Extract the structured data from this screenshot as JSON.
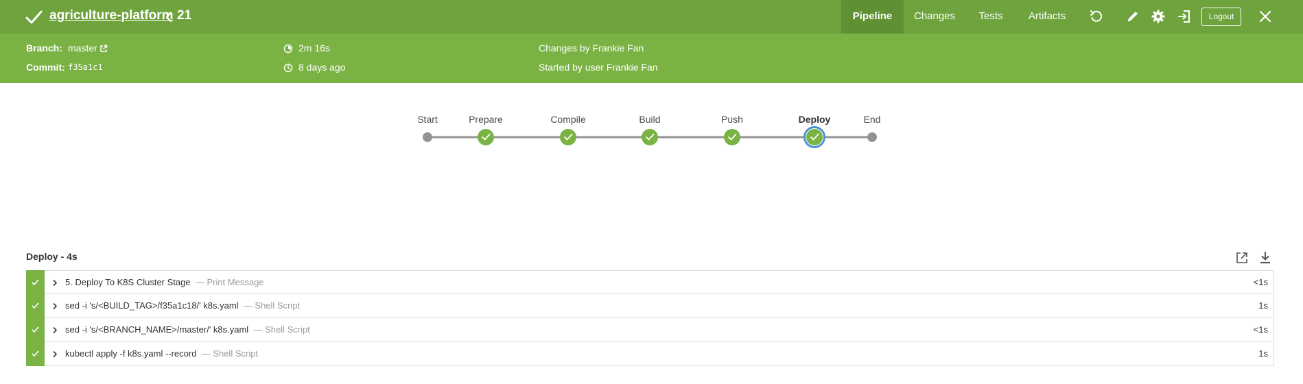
{
  "header": {
    "project": "agriculture-platform",
    "run_number": "21",
    "tabs": [
      {
        "label": "Pipeline"
      },
      {
        "label": "Changes"
      },
      {
        "label": "Tests"
      },
      {
        "label": "Artifacts"
      }
    ],
    "logout_label": "Logout",
    "icons": [
      "check-icon",
      "chevron-left-icon",
      "replay-icon",
      "edit-icon",
      "settings-icon",
      "sign-in-icon",
      "close-icon"
    ]
  },
  "summary": {
    "branch_label": "Branch:",
    "branch_value": "master",
    "commit_label": "Commit:",
    "commit_value": "f35a1c1",
    "duration": "2m 16s",
    "time_ago": "8 days ago",
    "changes_by": "Changes by Frankie Fan",
    "started_by": "Started by user Frankie Fan"
  },
  "pipeline": {
    "stages": [
      {
        "label": "Start",
        "status": "none"
      },
      {
        "label": "Prepare",
        "status": "success"
      },
      {
        "label": "Compile",
        "status": "success"
      },
      {
        "label": "Build",
        "status": "success"
      },
      {
        "label": "Push",
        "status": "success"
      },
      {
        "label": "Deploy",
        "status": "success-selected"
      },
      {
        "label": "End",
        "status": "none"
      }
    ]
  },
  "steps_panel": {
    "title": "Deploy - 4s",
    "steps": [
      {
        "title": "5. Deploy To K8S Cluster Stage",
        "type": "— Print Message",
        "duration": "<1s"
      },
      {
        "title": "sed -i 's/<BUILD_TAG>/f35a1c18/' k8s.yaml",
        "type": "— Shell Script",
        "duration": "1s"
      },
      {
        "title": "sed -i 's/<BRANCH_NAME>/master/' k8s.yaml",
        "type": "— Shell Script",
        "duration": "<1s"
      },
      {
        "title": "kubectl apply -f k8s.yaml --record",
        "type": "— Shell Script",
        "duration": "1s"
      }
    ]
  },
  "colors": {
    "header_bg": "#6ea33d",
    "subbar_bg": "#7ab344",
    "success": "#7ab344",
    "selected_ring": "#4a90d9",
    "node_gray": "#949393"
  }
}
